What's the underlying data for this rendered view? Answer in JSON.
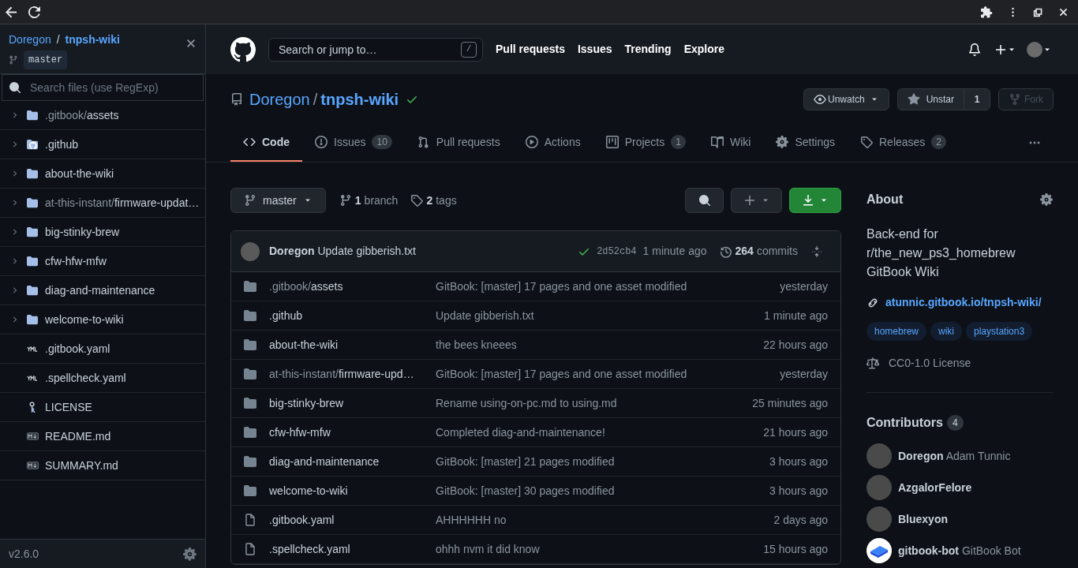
{
  "sidebar": {
    "owner": "Doregon",
    "separator": "/",
    "repo": "tnpsh-wiki",
    "branch": "master",
    "search": {
      "placeholder": "Search files (use RegExp)"
    },
    "items": [
      {
        "kind": "folder",
        "prefix": ".gitbook/",
        "name": "assets",
        "expanded": false
      },
      {
        "kind": "github-folder",
        "name": ".github",
        "expanded": false
      },
      {
        "kind": "folder",
        "name": "about-the-wiki",
        "expanded": false
      },
      {
        "kind": "folder",
        "prefix": "at-this-instant/",
        "name": "firmware-updat…",
        "expanded": false
      },
      {
        "kind": "folder",
        "name": "big-stinky-brew",
        "expanded": false
      },
      {
        "kind": "folder",
        "name": "cfw-hfw-mfw",
        "expanded": false
      },
      {
        "kind": "folder",
        "name": "diag-and-maintenance",
        "expanded": false
      },
      {
        "kind": "folder",
        "name": "welcome-to-wiki",
        "expanded": false
      },
      {
        "kind": "yaml",
        "name": ".gitbook.yaml"
      },
      {
        "kind": "yaml",
        "name": ".spellcheck.yaml"
      },
      {
        "kind": "license",
        "name": "LICENSE"
      },
      {
        "kind": "markdown",
        "name": "README.md"
      },
      {
        "kind": "markdown",
        "name": "SUMMARY.md"
      }
    ],
    "version": "v2.6.0"
  },
  "header": {
    "search": {
      "placeholder": "Search or jump to…",
      "shortcut": "/"
    },
    "nav": [
      "Pull requests",
      "Issues",
      "Trending",
      "Explore"
    ]
  },
  "repo": {
    "owner": "Doregon",
    "separator": "/",
    "name": "tnpsh-wiki",
    "watch": "Unwatch",
    "star": "Unstar",
    "stars": "1",
    "fork": "Fork"
  },
  "tabs": [
    {
      "kind": "code",
      "label": "Code",
      "selected": true
    },
    {
      "kind": "issues",
      "label": "Issues",
      "count": "10",
      "selected": false
    },
    {
      "kind": "pulls",
      "label": "Pull requests",
      "selected": false
    },
    {
      "kind": "actions",
      "label": "Actions",
      "selected": false
    },
    {
      "kind": "projects",
      "label": "Projects",
      "count": "1",
      "selected": false
    },
    {
      "kind": "wiki",
      "label": "Wiki",
      "selected": false
    },
    {
      "kind": "settings",
      "label": "Settings",
      "selected": false
    },
    {
      "kind": "releases",
      "label": "Releases",
      "count": "2",
      "selected": false
    }
  ],
  "branch_bar": {
    "branch": "master",
    "branches_count": "1",
    "branches_label": "branch",
    "tags_count": "2",
    "tags_label": "tags"
  },
  "commit": {
    "author": "Doregon",
    "message": "Update gibberish.txt",
    "sha": "2d52cb4",
    "time": "1 minute ago",
    "commits_count": "264",
    "commits_label": "commits"
  },
  "files": [
    {
      "kind": "folder",
      "prefix": ".gitbook/",
      "name": "assets",
      "message": "GitBook: [master] 17 pages and one asset modified",
      "time": "yesterday"
    },
    {
      "kind": "folder",
      "name": ".github",
      "message": "Update gibberish.txt",
      "time": "1 minute ago"
    },
    {
      "kind": "folder",
      "name": "about-the-wiki",
      "message": "the bees kneees",
      "time": "22 hours ago"
    },
    {
      "kind": "folder",
      "prefix": "at-this-instant/",
      "name": "firmware-upd…",
      "message": "GitBook: [master] 17 pages and one asset modified",
      "time": "yesterday"
    },
    {
      "kind": "folder",
      "name": "big-stinky-brew",
      "message": "Rename using-on-pc.md to using.md",
      "time": "25 minutes ago"
    },
    {
      "kind": "folder",
      "name": "cfw-hfw-mfw",
      "message": "Completed diag-and-maintenance!",
      "time": "21 hours ago"
    },
    {
      "kind": "folder",
      "name": "diag-and-maintenance",
      "message": "GitBook: [master] 21 pages modified",
      "time": "3 hours ago"
    },
    {
      "kind": "folder",
      "name": "welcome-to-wiki",
      "message": "GitBook: [master] 30 pages modified",
      "time": "3 hours ago"
    },
    {
      "kind": "file",
      "name": ".gitbook.yaml",
      "message": "AHHHHHH no",
      "time": "2 days ago"
    },
    {
      "kind": "file",
      "name": ".spellcheck.yaml",
      "message": "ohhh nvm it did know",
      "time": "15 hours ago"
    }
  ],
  "about": {
    "title": "About",
    "description": "Back-end for r/the_new_ps3_homebrew GitBook Wiki",
    "link": "atunnic.gitbook.io/tnpsh-wiki/",
    "topics": [
      "homebrew",
      "wiki",
      "playstation3"
    ],
    "license": "CC0-1.0 License"
  },
  "contributors": {
    "title": "Contributors",
    "count": "4",
    "people": [
      {
        "login": "Doregon",
        "name": "Adam Tunnic",
        "kind": "photo"
      },
      {
        "login": "AzgalorFelore",
        "kind": "photo"
      },
      {
        "login": "Bluexyon",
        "kind": "photo"
      },
      {
        "login": "gitbook-bot",
        "name": "GitBook Bot",
        "kind": "book"
      }
    ]
  }
}
